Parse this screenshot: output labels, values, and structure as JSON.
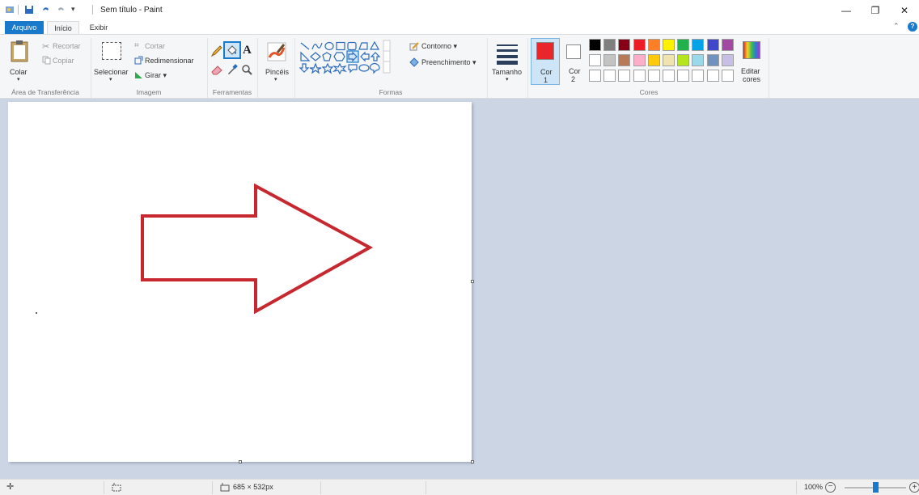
{
  "titlebar": {
    "title": "Sem título - Paint",
    "minimize": "—",
    "maximize": "❐",
    "close": "✕"
  },
  "tabs": {
    "file": "Arquivo",
    "home": "Início",
    "view": "Exibir"
  },
  "ribbon": {
    "clipboard": {
      "paste": "Colar",
      "cut": "Recortar",
      "copy": "Copiar",
      "label": "Área de Transferência"
    },
    "image": {
      "select": "Selecionar",
      "crop": "Cortar",
      "resize": "Redimensionar",
      "rotate": "Girar ▾",
      "label": "Imagem"
    },
    "tools": {
      "label": "Ferramentas",
      "text_glyph": "A"
    },
    "brushes": {
      "label": "Pincéis"
    },
    "shapes": {
      "outline": "Contorno ▾",
      "fill": "Preenchimento ▾",
      "label": "Formas"
    },
    "size": {
      "label": "Tamanho"
    },
    "colors": {
      "color1": "Cor",
      "color1_num": "1",
      "color2": "Cor",
      "color2_num": "2",
      "edit": "Editar",
      "edit2": "cores",
      "label": "Cores",
      "color1_value": "#e8262c",
      "color2_value": "#ffffff",
      "row1": [
        "#000000",
        "#7f7f7f",
        "#880015",
        "#ed1c24",
        "#ff7f27",
        "#fff200",
        "#22b14c",
        "#00a2e8",
        "#3f48cc",
        "#a349a4"
      ],
      "row2": [
        "#ffffff",
        "#c3c3c3",
        "#b97a57",
        "#ffaec9",
        "#ffc90e",
        "#efe4b0",
        "#b5e61d",
        "#99d9ea",
        "#7092be",
        "#c8bfe7"
      ]
    }
  },
  "canvas": {
    "stroke_color": "#c7282f"
  },
  "status": {
    "size": "685 × 532px",
    "zoom": "100%",
    "zoom_level": 0.5
  }
}
